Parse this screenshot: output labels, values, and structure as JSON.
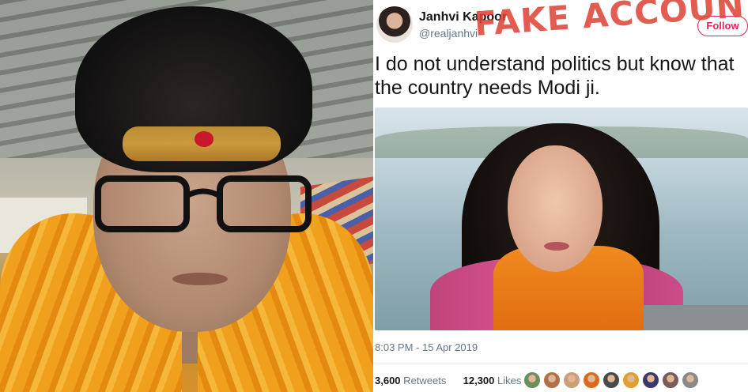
{
  "tweet": {
    "author_name": "Janhvi Kapoor",
    "author_handle": "@realjanhvi",
    "follow_label": "Follow",
    "overlay_stamp": "FAKE ACCOUNT",
    "text_lines": [
      "I do not understand politics but know that",
      "the country needs Modi ji."
    ],
    "timestamp": "8:03 PM - 15 Apr 2019",
    "retweets_count": "3,600",
    "retweets_label": "Retweets",
    "likes_count": "12,300",
    "likes_label": "Likes",
    "liker_avatar_colors": [
      "#6a8f5a",
      "#b0714a",
      "#c9a07a",
      "#d96a1e",
      "#4a4a4a",
      "#e0a030",
      "#3a3a6a",
      "#7a5a5a",
      "#8a8a8a"
    ]
  },
  "colors": {
    "stamp": "#de4034",
    "follow_accent": "#e0245e",
    "muted_text": "#657786",
    "primary_text": "#14171a"
  }
}
